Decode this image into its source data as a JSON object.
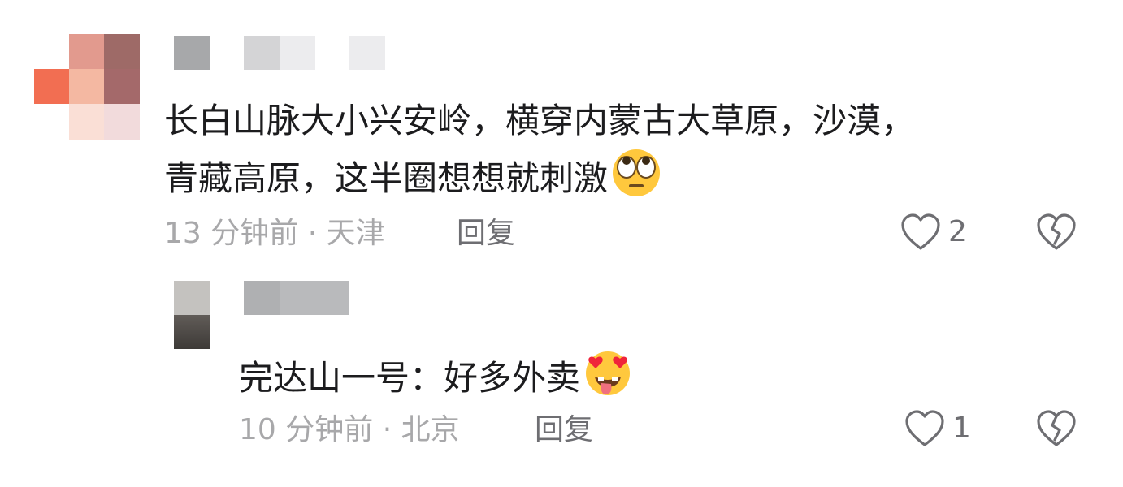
{
  "comment": {
    "text_line1": "长白山脉大小兴安岭，横穿内蒙古大草原，沙漠，",
    "text_line2": "青藏高原，这半圈想想就刺激",
    "text_emoji": "flushed-eye-roll-emoji",
    "meta": "13 分钟前 · 天津",
    "reply_label": "回复",
    "like_count": "2",
    "like_icon": "heart-outline-icon",
    "dislike_icon": "broken-heart-outline-icon"
  },
  "reply": {
    "text": "完达山一号：好多外卖",
    "text_emoji": "heart-eyes-tongue-emoji",
    "meta": "10 分钟前 · 北京",
    "reply_label": "回复",
    "like_count": "1",
    "like_icon": "heart-outline-icon",
    "dislike_icon": "broken-heart-outline-icon"
  },
  "colors": {
    "text": "#1c1c1e",
    "meta": "#a8a8aa",
    "action": "#6e6e72",
    "emoji_face": "#ffc83d"
  }
}
